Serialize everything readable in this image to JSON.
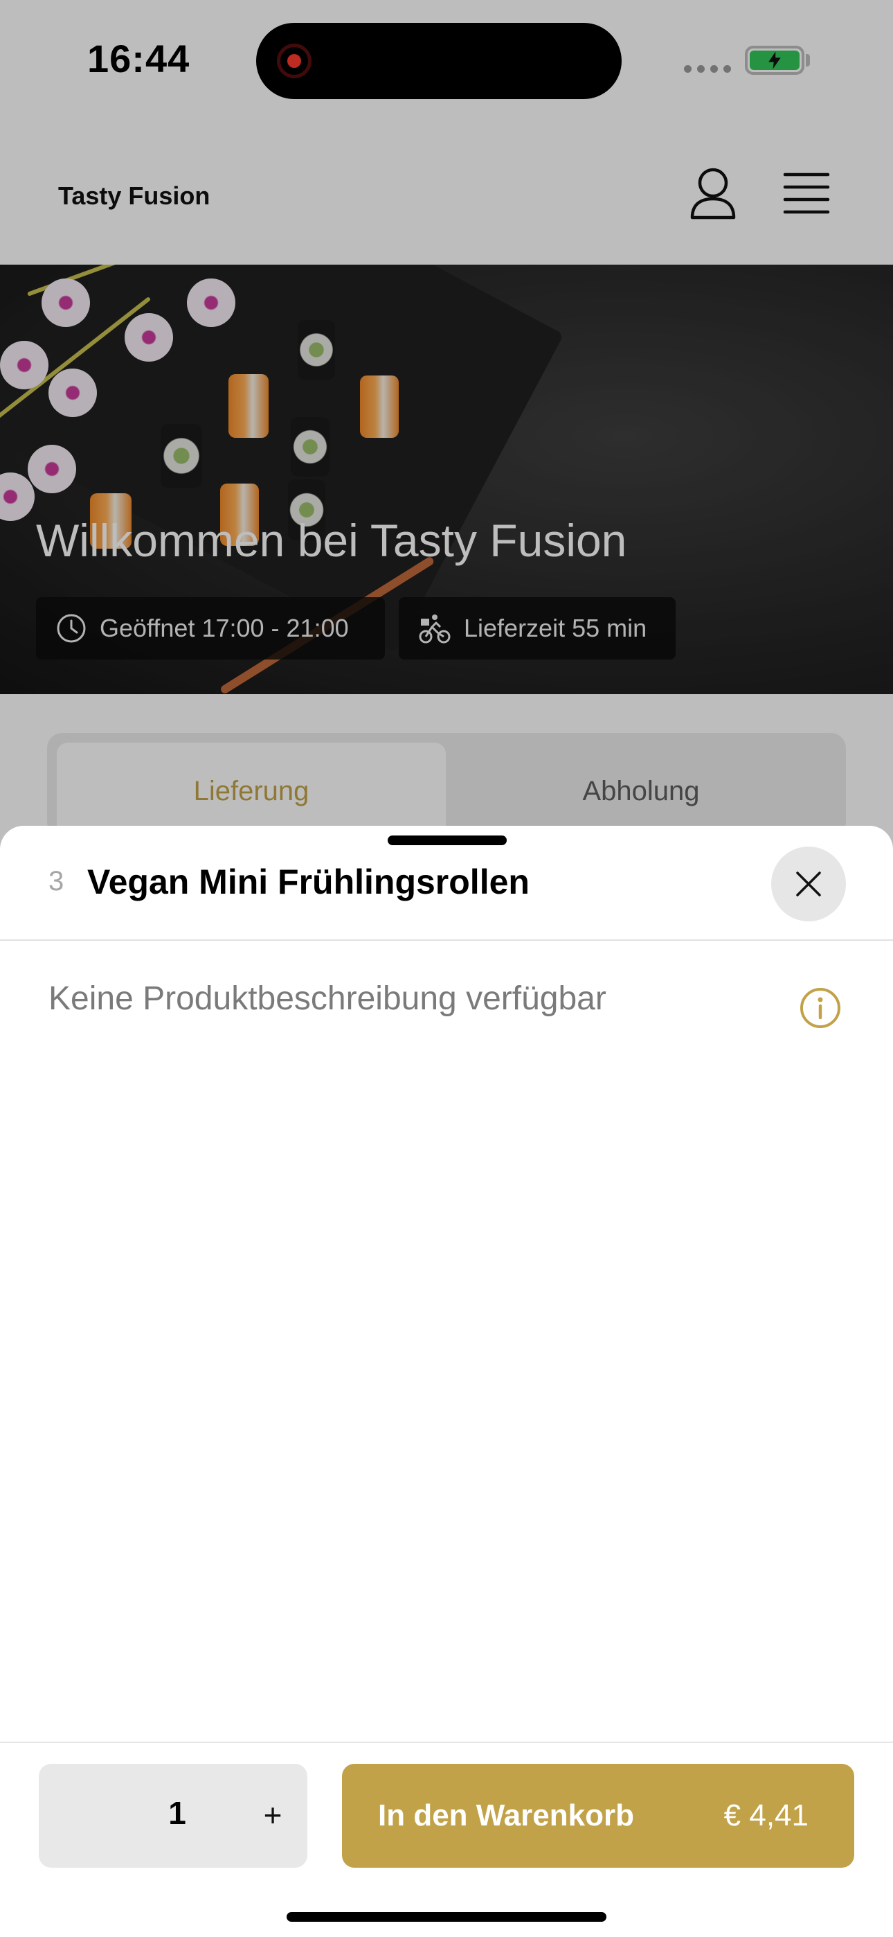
{
  "status_bar": {
    "time": "16:44",
    "battery_state": "charging"
  },
  "header": {
    "brand": "Tasty Fusion"
  },
  "hero": {
    "title": "Willkommen bei Tasty Fusion",
    "opening_hours": "Geöffnet 17:00 - 21:00",
    "delivery_time": "Lieferzeit 55 min"
  },
  "order_mode": {
    "tabs": [
      {
        "label": "Lieferung",
        "active": true
      },
      {
        "label": "Abholung",
        "active": false
      }
    ]
  },
  "product_sheet": {
    "number": "3",
    "title": "Vegan Mini Frühlingsrollen",
    "description": "Keine Produktbeschreibung verfügbar"
  },
  "footer": {
    "quantity": "1",
    "plus_symbol": "+",
    "cart_label": "In den Warenkorb",
    "price": "€ 4,41"
  },
  "colors": {
    "accent": "#c1a248",
    "battery": "#34c759",
    "record": "#ff3b30"
  }
}
